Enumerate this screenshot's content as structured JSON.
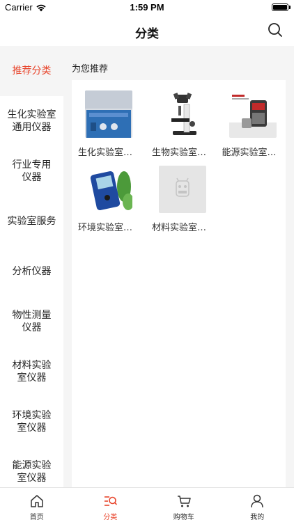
{
  "status_bar": {
    "carrier": "Carrier",
    "time": "1:59 PM"
  },
  "nav": {
    "title": "分类",
    "search_icon": "search-icon"
  },
  "sidebar": {
    "items": [
      {
        "label": "推荐分类",
        "active": true
      },
      {
        "label": "生化实验室通用仪器"
      },
      {
        "label": "行业专用仪器"
      },
      {
        "label": "实验室服务"
      },
      {
        "label": "分析仪器"
      },
      {
        "label": "物性测量仪器"
      },
      {
        "label": "材料实验室仪器"
      },
      {
        "label": "环境实验室仪器"
      },
      {
        "label": "能源实验室仪器"
      }
    ]
  },
  "content": {
    "section_title": "为您推荐",
    "items": [
      {
        "label": "生化实验室通用仪器",
        "image": "lab-instrument-photo"
      },
      {
        "label": "生物实验室仪器",
        "image": "microscope-photo"
      },
      {
        "label": "能源实验室仪器",
        "image": "energy-instrument-photo"
      },
      {
        "label": "环境实验室仪器",
        "image": "handheld-meter-photo"
      },
      {
        "label": "材料实验室仪器",
        "image": "placeholder-image"
      }
    ]
  },
  "tabbar": {
    "tabs": [
      {
        "label": "首页",
        "icon": "home-icon"
      },
      {
        "label": "分类",
        "icon": "category-icon",
        "active": true
      },
      {
        "label": "购物车",
        "icon": "cart-icon"
      },
      {
        "label": "我的",
        "icon": "user-icon"
      }
    ]
  },
  "colors": {
    "accent": "#e8452c",
    "sidebar_bg": "#f5f5f5",
    "panel_bg": "#ffffff"
  }
}
